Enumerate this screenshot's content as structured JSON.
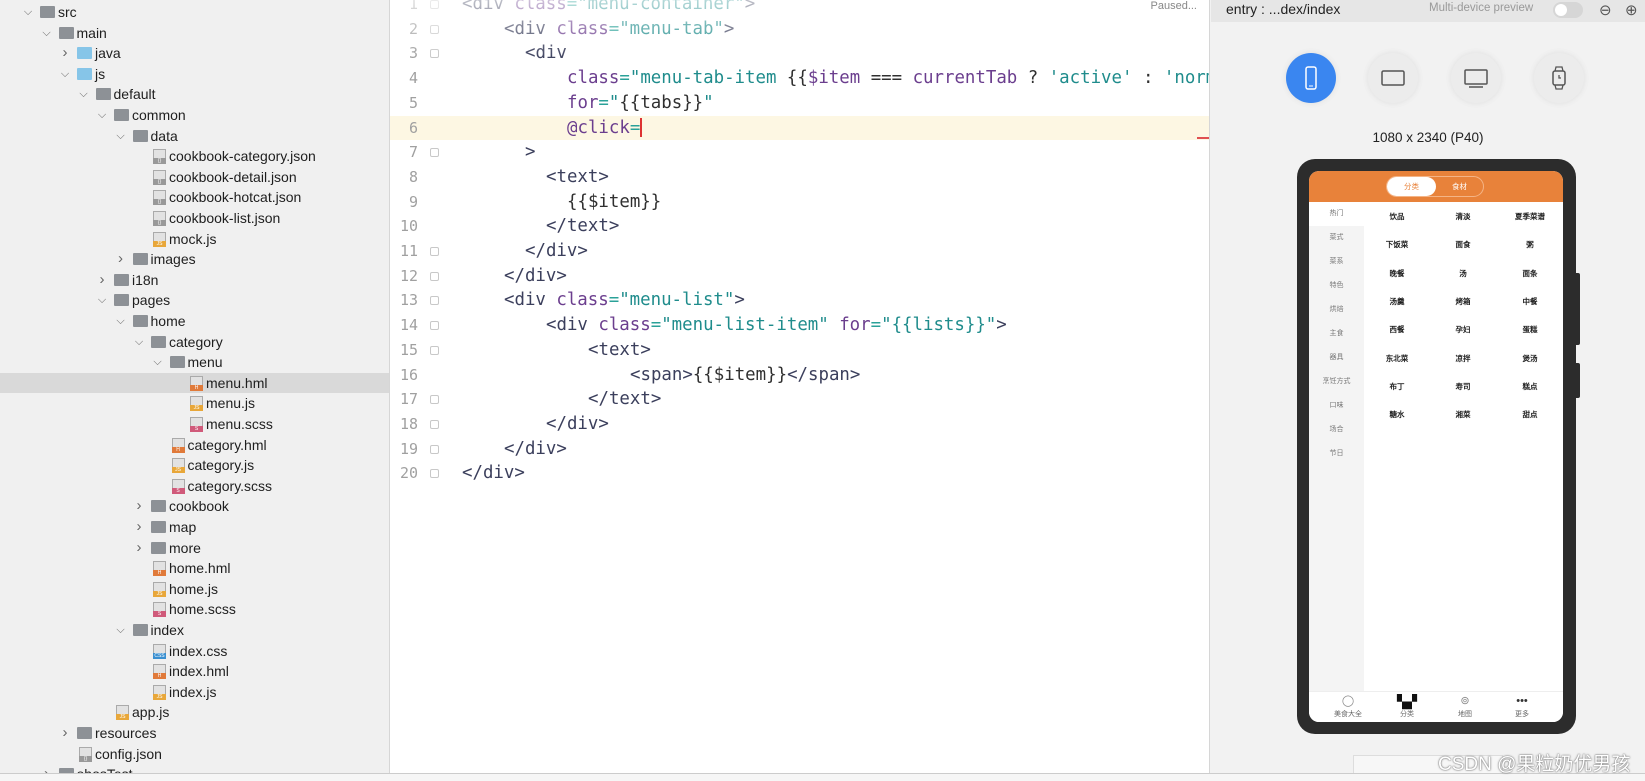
{
  "tree": [
    {
      "label": "src",
      "level": 0,
      "type": "folder",
      "open": true
    },
    {
      "label": "main",
      "level": 1,
      "type": "folder",
      "open": true
    },
    {
      "label": "java",
      "level": 2,
      "type": "folder-blue",
      "open": false
    },
    {
      "label": "js",
      "level": 2,
      "type": "folder-blue",
      "open": true
    },
    {
      "label": "default",
      "level": 3,
      "type": "folder",
      "open": true
    },
    {
      "label": "common",
      "level": 4,
      "type": "folder",
      "open": true
    },
    {
      "label": "data",
      "level": 5,
      "type": "folder",
      "open": true
    },
    {
      "label": "cookbook-category.json",
      "level": 6,
      "type": "json"
    },
    {
      "label": "cookbook-detail.json",
      "level": 6,
      "type": "json"
    },
    {
      "label": "cookbook-hotcat.json",
      "level": 6,
      "type": "json"
    },
    {
      "label": "cookbook-list.json",
      "level": 6,
      "type": "json"
    },
    {
      "label": "mock.js",
      "level": 6,
      "type": "js"
    },
    {
      "label": "images",
      "level": 5,
      "type": "folder",
      "open": false
    },
    {
      "label": "i18n",
      "level": 4,
      "type": "folder",
      "open": false
    },
    {
      "label": "pages",
      "level": 4,
      "type": "folder",
      "open": true
    },
    {
      "label": "home",
      "level": 5,
      "type": "folder",
      "open": true
    },
    {
      "label": "category",
      "level": 6,
      "type": "folder",
      "open": true
    },
    {
      "label": "menu",
      "level": 7,
      "type": "folder",
      "open": true
    },
    {
      "label": "menu.hml",
      "level": 8,
      "type": "hml",
      "selected": true
    },
    {
      "label": "menu.js",
      "level": 8,
      "type": "js"
    },
    {
      "label": "menu.scss",
      "level": 8,
      "type": "scss"
    },
    {
      "label": "category.hml",
      "level": 7,
      "type": "hml"
    },
    {
      "label": "category.js",
      "level": 7,
      "type": "js"
    },
    {
      "label": "category.scss",
      "level": 7,
      "type": "scss"
    },
    {
      "label": "cookbook",
      "level": 6,
      "type": "folder",
      "open": false
    },
    {
      "label": "map",
      "level": 6,
      "type": "folder",
      "open": false
    },
    {
      "label": "more",
      "level": 6,
      "type": "folder",
      "open": false
    },
    {
      "label": "home.hml",
      "level": 6,
      "type": "hml"
    },
    {
      "label": "home.js",
      "level": 6,
      "type": "js"
    },
    {
      "label": "home.scss",
      "level": 6,
      "type": "scss"
    },
    {
      "label": "index",
      "level": 5,
      "type": "folder",
      "open": true
    },
    {
      "label": "index.css",
      "level": 6,
      "type": "css"
    },
    {
      "label": "index.hml",
      "level": 6,
      "type": "hml"
    },
    {
      "label": "index.js",
      "level": 6,
      "type": "js"
    },
    {
      "label": "app.js",
      "level": 4,
      "type": "js"
    },
    {
      "label": "resources",
      "level": 2,
      "type": "folder",
      "open": false
    },
    {
      "label": "config.json",
      "level": 2,
      "type": "json"
    },
    {
      "label": "ohosTest",
      "level": 1,
      "type": "folder",
      "open": false
    }
  ],
  "file_tags": {
    "js": "JS",
    "hml": "H",
    "css": "CSS",
    "json": "{}",
    "scss": "S"
  },
  "editor": {
    "status": "Paused...",
    "current_line": 6,
    "lines": [
      {
        "n": "1",
        "indent": 0,
        "tokens": [
          [
            "<div ",
            "tag"
          ],
          [
            "class",
            "attr"
          ],
          [
            "=",
            "eq"
          ],
          [
            "\"menu-container\"",
            "str"
          ],
          [
            ">",
            "tag"
          ]
        ]
      },
      {
        "n": "2",
        "indent": 4,
        "tokens": [
          [
            "<div ",
            "tag"
          ],
          [
            "class",
            "attr"
          ],
          [
            "=",
            "eq"
          ],
          [
            "\"menu-tab\"",
            "str"
          ],
          [
            ">",
            "tag"
          ]
        ]
      },
      {
        "n": "3",
        "indent": 6,
        "tokens": [
          [
            "<div",
            "tag"
          ]
        ]
      },
      {
        "n": "4",
        "indent": 10,
        "tokens": [
          [
            "class",
            "attr"
          ],
          [
            "=",
            "eq"
          ],
          [
            "\"menu-tab-item ",
            "str"
          ],
          [
            "{{",
            "plain"
          ],
          [
            "$item",
            "var"
          ],
          [
            " === ",
            "plain"
          ],
          [
            "currentTab",
            "var"
          ],
          [
            " ? ",
            "plain"
          ],
          [
            "'active'",
            "str"
          ],
          [
            " : ",
            "plain"
          ],
          [
            "'normal'",
            "str"
          ],
          [
            "}}",
            "plain"
          ],
          [
            "\"",
            "str"
          ]
        ]
      },
      {
        "n": "5",
        "indent": 10,
        "tokens": [
          [
            "for",
            "attr"
          ],
          [
            "=",
            "eq"
          ],
          [
            "\"",
            "str"
          ],
          [
            "{{tabs}}",
            "plain"
          ],
          [
            "\"",
            "str"
          ]
        ]
      },
      {
        "n": "6",
        "indent": 10,
        "tokens": [
          [
            "@click",
            "attr"
          ],
          [
            "=",
            "eq"
          ]
        ],
        "caret": true
      },
      {
        "n": "7",
        "indent": 6,
        "tokens": [
          [
            ">",
            "tag"
          ]
        ]
      },
      {
        "n": "8",
        "indent": 8,
        "tokens": [
          [
            "<text>",
            "tag"
          ]
        ]
      },
      {
        "n": "9",
        "indent": 10,
        "tokens": [
          [
            "{{$item}}",
            "plain"
          ]
        ]
      },
      {
        "n": "10",
        "indent": 8,
        "tokens": [
          [
            "</text>",
            "tag"
          ]
        ]
      },
      {
        "n": "11",
        "indent": 6,
        "tokens": [
          [
            "</div>",
            "tag"
          ]
        ]
      },
      {
        "n": "12",
        "indent": 4,
        "tokens": [
          [
            "</div>",
            "tag"
          ]
        ]
      },
      {
        "n": "13",
        "indent": 4,
        "tokens": [
          [
            "<div ",
            "tag"
          ],
          [
            "class",
            "attr"
          ],
          [
            "=",
            "eq"
          ],
          [
            "\"menu-list\"",
            "str"
          ],
          [
            ">",
            "tag"
          ]
        ]
      },
      {
        "n": "14",
        "indent": 8,
        "tokens": [
          [
            "<div ",
            "tag"
          ],
          [
            "class",
            "attr"
          ],
          [
            "=",
            "eq"
          ],
          [
            "\"menu-list-item\" ",
            "str"
          ],
          [
            "for",
            "attr"
          ],
          [
            "=",
            "eq"
          ],
          [
            "\"{{lists}}\"",
            "str"
          ],
          [
            ">",
            "tag"
          ]
        ]
      },
      {
        "n": "15",
        "indent": 12,
        "tokens": [
          [
            "<text>",
            "tag"
          ]
        ]
      },
      {
        "n": "16",
        "indent": 16,
        "tokens": [
          [
            "<span>",
            "tag"
          ],
          [
            "{{$item}}",
            "plain"
          ],
          [
            "</span>",
            "tag"
          ]
        ]
      },
      {
        "n": "17",
        "indent": 12,
        "tokens": [
          [
            "</text>",
            "tag"
          ]
        ]
      },
      {
        "n": "18",
        "indent": 8,
        "tokens": [
          [
            "</div>",
            "tag"
          ]
        ]
      },
      {
        "n": "19",
        "indent": 4,
        "tokens": [
          [
            "</div>",
            "tag"
          ]
        ]
      },
      {
        "n": "20",
        "indent": 0,
        "tokens": [
          [
            "</div>",
            "tag"
          ]
        ]
      }
    ]
  },
  "preview": {
    "title": "entry : ...dex/index",
    "multi_device_label": "Multi-device preview",
    "multi_device_on": false,
    "zoom_out_icon": "zoom-out-icon",
    "zoom_in_icon": "zoom-in-icon",
    "devices": [
      {
        "name": "phone",
        "active": true
      },
      {
        "name": "tablet",
        "active": false
      },
      {
        "name": "tv",
        "active": false
      },
      {
        "name": "watch",
        "active": false
      }
    ],
    "resolution": "1080 x 2340 (P40)",
    "accent": "#3a86f0"
  },
  "app": {
    "brand_color": "#e8823a",
    "tabs": [
      "分类",
      "食材"
    ],
    "active_tab": 0,
    "side_items": [
      "热门",
      "菜式",
      "菜系",
      "特色",
      "烘焙",
      "主食",
      "器具",
      "烹饪方式",
      "口味",
      "场合",
      "节日"
    ],
    "active_side": 0,
    "grid": [
      [
        "饮品",
        "清淡",
        "夏季菜谱"
      ],
      [
        "下饭菜",
        "面食",
        "粥"
      ],
      [
        "晚餐",
        "汤",
        "面条"
      ],
      [
        "汤羹",
        "烤箱",
        "中餐"
      ],
      [
        "西餐",
        "孕妇",
        "蛋糕"
      ],
      [
        "东北菜",
        "凉拌",
        "煲汤"
      ],
      [
        "布丁",
        "寿司",
        "糕点"
      ],
      [
        "糖水",
        "湘菜",
        "甜点"
      ]
    ],
    "bottom_tabs": [
      {
        "label": "美食大全",
        "icon": "bowl-icon"
      },
      {
        "label": "分类",
        "icon": "grid-icon",
        "active": true
      },
      {
        "label": "地图",
        "icon": "map-pin-icon"
      },
      {
        "label": "更多",
        "icon": "more-icon"
      }
    ]
  },
  "watermark": "CSDN @果粒奶优男孩"
}
